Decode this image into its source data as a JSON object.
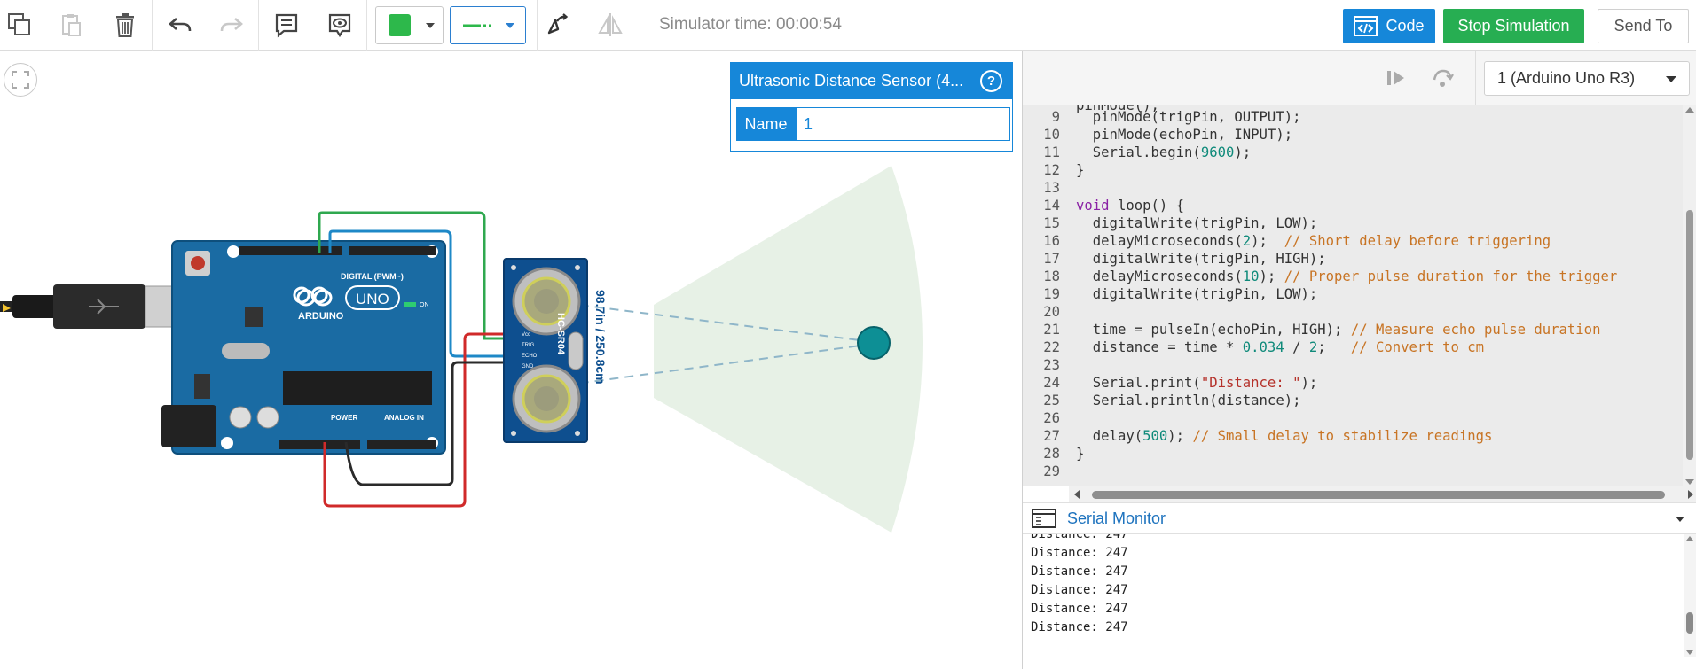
{
  "toolbar": {
    "icons": [
      "copy-icon",
      "paste-icon",
      "delete-icon",
      "undo-icon",
      "redo-icon",
      "notes-icon",
      "visibility-icon",
      "color-swatch-icon",
      "wire-style-icon",
      "rotate-icon",
      "flip-icon"
    ],
    "color_swatch": "#2db84b",
    "simulator_time": "Simulator time: 00:00:54",
    "code_label": "Code",
    "stop_label": "Stop Simulation",
    "send_label": "Send To"
  },
  "properties": {
    "title": "Ultrasonic Distance Sensor (4...",
    "help": "?",
    "name_label": "Name",
    "name_value": "1"
  },
  "circuit": {
    "board_text": [
      "DIGITAL (PWM~)",
      "ARDUINO",
      "UNO",
      "POWER",
      "ANALOG IN",
      "ON"
    ],
    "sensor_label": "HC-SR04",
    "sensor_pins": [
      "Vcc",
      "TRIG",
      "ECHO",
      "GND"
    ],
    "distance_readout": "98.7in / 250.8cm"
  },
  "code_panel": {
    "board_selector": "1 (Arduino Uno R3)",
    "lines": [
      {
        "n": "9",
        "t": "  pinMode(trigPin, OUTPUT);"
      },
      {
        "n": "10",
        "t": "  pinMode(echoPin, INPUT);"
      },
      {
        "n": "11",
        "t": "  Serial.begin(9600);"
      },
      {
        "n": "12",
        "t": "}"
      },
      {
        "n": "13",
        "t": ""
      },
      {
        "n": "14",
        "t": "void loop() {"
      },
      {
        "n": "15",
        "t": "  digitalWrite(trigPin, LOW);"
      },
      {
        "n": "16",
        "t": "  delayMicroseconds(2);  // Short delay before triggering"
      },
      {
        "n": "17",
        "t": "  digitalWrite(trigPin, HIGH);"
      },
      {
        "n": "18",
        "t": "  delayMicroseconds(10); // Proper pulse duration for the trigger"
      },
      {
        "n": "19",
        "t": "  digitalWrite(trigPin, LOW);"
      },
      {
        "n": "20",
        "t": ""
      },
      {
        "n": "21",
        "t": "  time = pulseIn(echoPin, HIGH); // Measure echo pulse duration"
      },
      {
        "n": "22",
        "t": "  distance = time * 0.034 / 2;   // Convert to cm"
      },
      {
        "n": "23",
        "t": ""
      },
      {
        "n": "24",
        "t": "  Serial.print(\"Distance: \");"
      },
      {
        "n": "25",
        "t": "  Serial.println(distance);"
      },
      {
        "n": "26",
        "t": ""
      },
      {
        "n": "27",
        "t": "  delay(500); // Small delay to stabilize readings"
      },
      {
        "n": "28",
        "t": "}"
      },
      {
        "n": "29",
        "t": ""
      }
    ]
  },
  "serial_monitor": {
    "title": "Serial Monitor",
    "lines": [
      "Distance: 247",
      "Distance: 247",
      "Distance: 247",
      "Distance: 247",
      "Distance: 247",
      "Distance: 247"
    ]
  }
}
